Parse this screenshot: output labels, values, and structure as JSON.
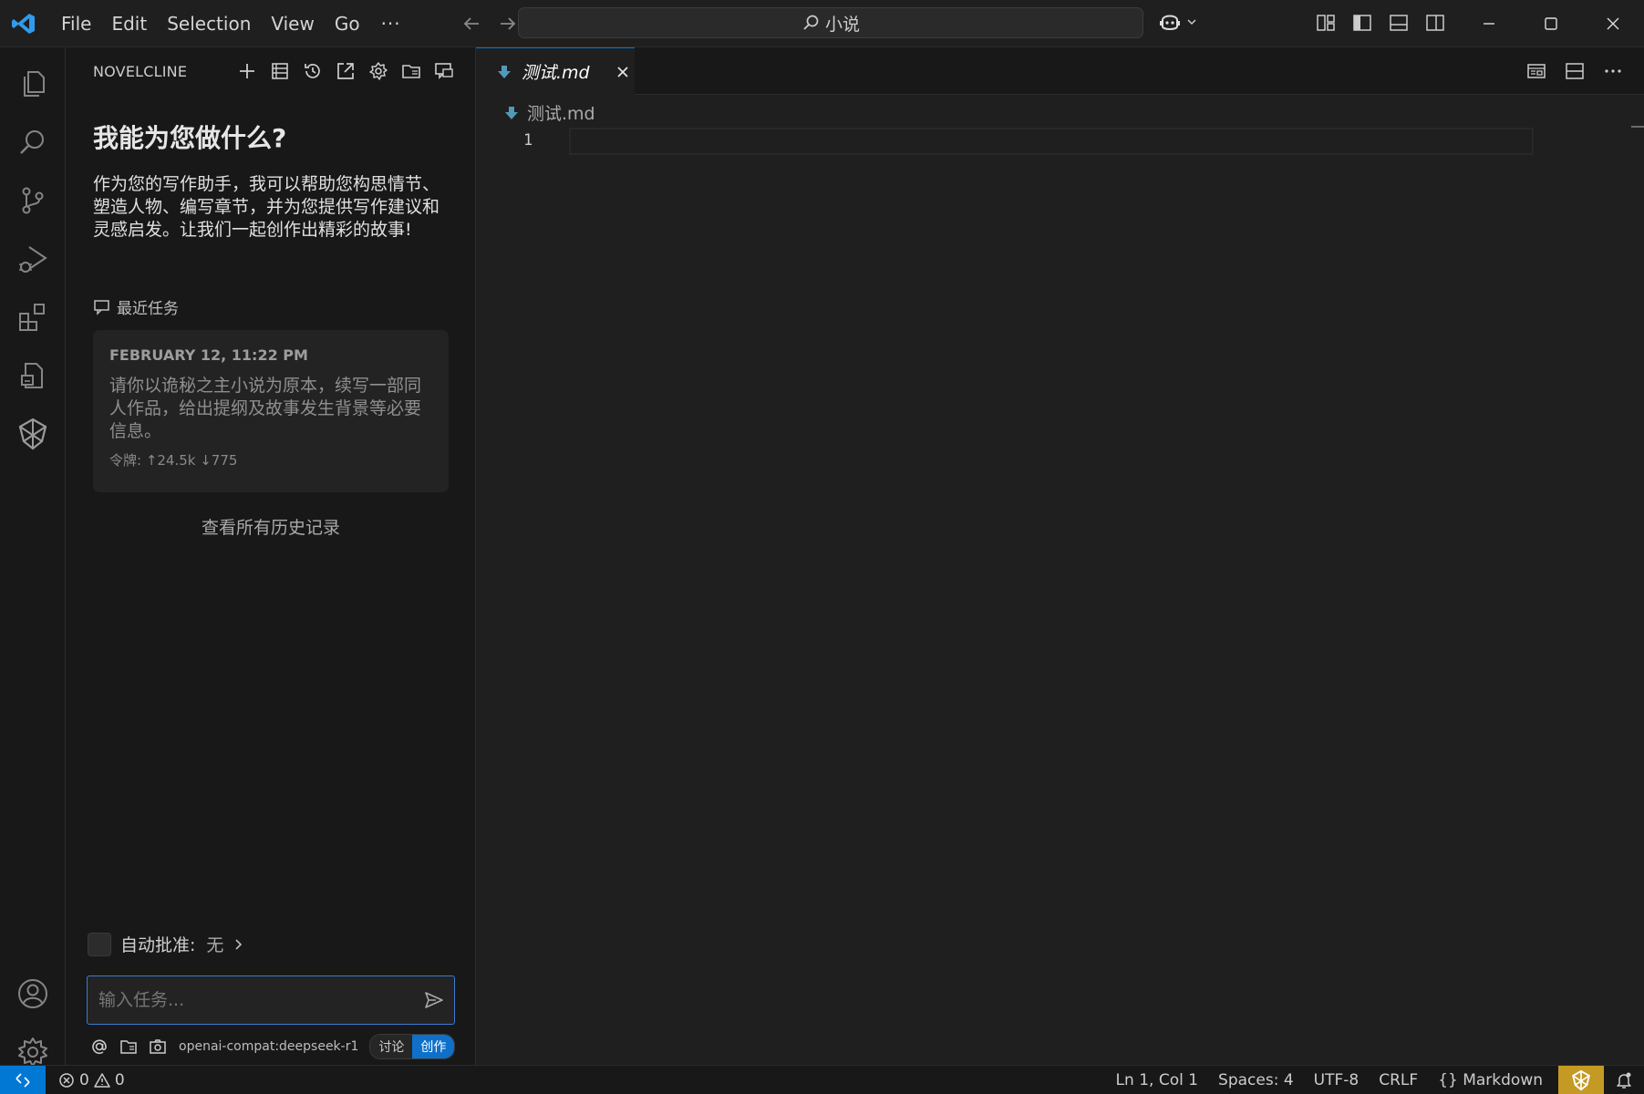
{
  "menu": {
    "items": [
      "File",
      "Edit",
      "Selection",
      "View",
      "Go"
    ],
    "more": "···"
  },
  "title_search": "小说",
  "panel": {
    "title": "NOVELCLINE",
    "welcome_title": "我能为您做什么?",
    "welcome_desc": "作为您的写作助手，我可以帮助您构思情节、塑造人物、编写章节，并为您提供写作建议和灵感启发。让我们一起创作出精彩的故事!",
    "recent_label": "最近任务",
    "recent_task": {
      "date": "FEBRUARY 12, 11:22 PM",
      "text": "请你以诡秘之主小说为原本，续写一部同人作品，给出提纲及故事发生背景等必要信息。",
      "tokens": "令牌: ↑24.5k ↓775"
    },
    "history_link": "查看所有历史记录",
    "auto_approve_label": "自动批准:",
    "auto_approve_value": "无",
    "input_placeholder": "输入任务...",
    "model": "openai-compat:deepseek-r1",
    "mode_discuss": "讨论",
    "mode_create": "创作"
  },
  "editor": {
    "tab_label": "测试.md",
    "breadcrumb": "测试.md",
    "line_number": "1"
  },
  "status": {
    "errors": "0",
    "warnings": "0",
    "position": "Ln 1, Col 1",
    "spaces": "Spaces: 4",
    "encoding": "UTF-8",
    "eol": "CRLF",
    "language_icon": "{}",
    "language": "Markdown"
  },
  "colors": {
    "accent": "#0078d4",
    "mode_active": "#0e70c9",
    "status_gold": "#c49a24",
    "markdown_icon": "#519aba"
  }
}
